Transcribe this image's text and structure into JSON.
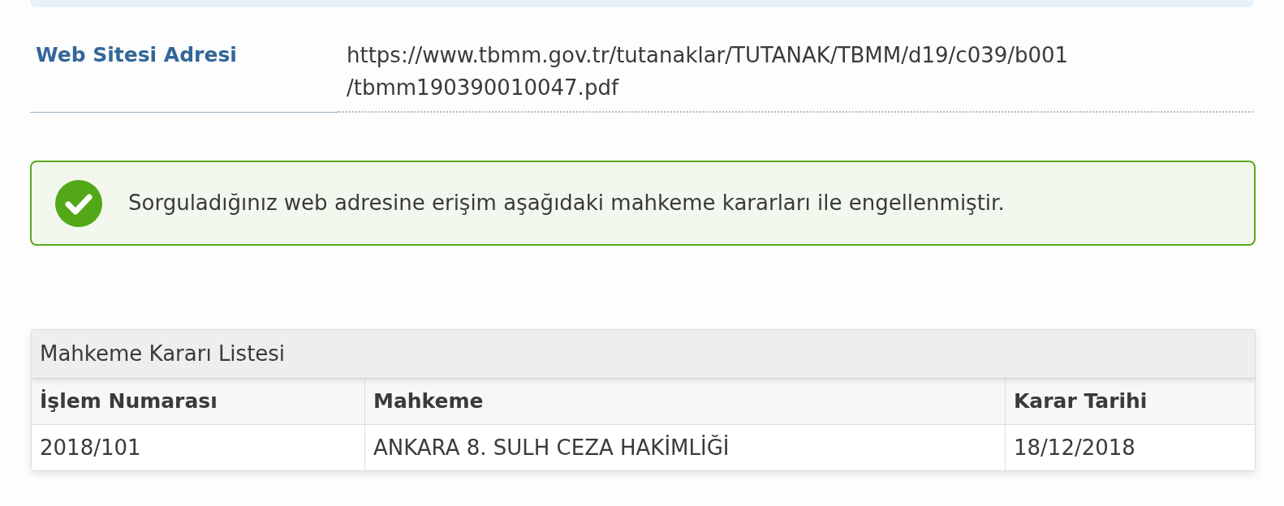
{
  "address": {
    "label": "Web Sitesi Adresi",
    "value_lines": [
      "https://www.tbmm.gov.tr/tutanaklar/TUTANAK/TBMM/d19/c039/b001",
      "/tbmm190390010047.pdf"
    ]
  },
  "alert": {
    "kind": "success",
    "message": "Sorguladığınız web adresine erişim aşağıdaki mahkeme kararları ile engellenmiştir."
  },
  "table": {
    "title": "Mahkeme Kararı Listesi",
    "columns": [
      "İşlem Numarası",
      "Mahkeme",
      "Karar Tarihi"
    ],
    "rows": [
      [
        "2018/101",
        "ANKARA 8. SULH CEZA HAKİMLİĞİ",
        "18/12/2018"
      ]
    ]
  }
}
